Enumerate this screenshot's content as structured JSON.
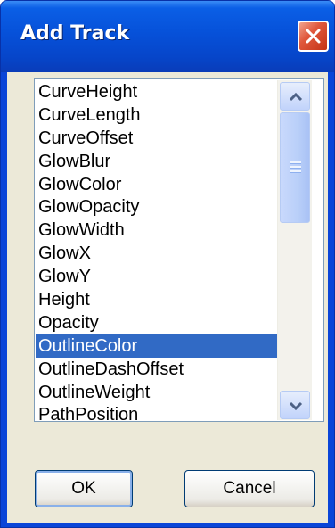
{
  "window": {
    "title": "Add Track",
    "close_icon": "close-x-icon"
  },
  "list": {
    "items": [
      "CurveHeight",
      "CurveLength",
      "CurveOffset",
      "GlowBlur",
      "GlowColor",
      "GlowOpacity",
      "GlowWidth",
      "GlowX",
      "GlowY",
      "Height",
      "Opacity",
      "OutlineColor",
      "OutlineDashOffset",
      "OutlineWeight",
      "PathPosition"
    ],
    "selected": "OutlineColor"
  },
  "buttons": {
    "ok": "OK",
    "cancel": "Cancel"
  },
  "colors": {
    "selection": "#316ac5",
    "title_bar": "#0651d9",
    "close": "#e0583c"
  }
}
